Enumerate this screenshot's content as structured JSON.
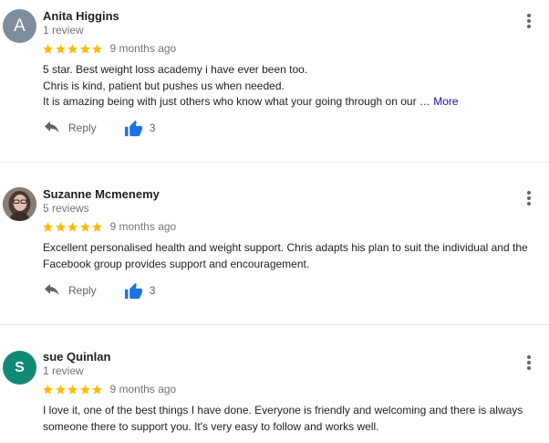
{
  "colors": {
    "star": "#fbbc04",
    "thumb": "#1a73e8",
    "avatar_a": "#7d8d9c",
    "avatar_s": "#0f8a74"
  },
  "icons": {
    "star": "star-icon",
    "reply": "reply-icon",
    "like": "thumbs-up-icon",
    "menu": "more-vert-icon"
  },
  "reviews": [
    {
      "name": "Anita Higgins",
      "count": "1 review",
      "avatar_letter": "A",
      "rating": 5,
      "time": "9 months ago",
      "lines": [
        "5 star. Best weight loss academy i have ever been too.",
        "Chris is kind, patient but pushes us when needed.",
        "It is amazing being with just others who know what your going through on our …"
      ],
      "more_label": "More",
      "reply_label": "Reply",
      "likes": "3"
    },
    {
      "name": "Suzanne Mcmenemy",
      "count": "5 reviews",
      "rating": 5,
      "time": "9 months ago",
      "lines": [
        "Excellent personalised health and weight support. Chris adapts his plan to suit the individual and the",
        "Facebook group provides support and encouragement."
      ],
      "reply_label": "Reply",
      "likes": "3"
    },
    {
      "name": "sue Quinlan",
      "count": "1 review",
      "avatar_letter": "S",
      "rating": 5,
      "time": "9 months ago",
      "lines": [
        "I love it, one of the best things I have done. Everyone is friendly and welcoming and there is always",
        "someone there to support you. It's very easy to follow and works well."
      ]
    }
  ]
}
